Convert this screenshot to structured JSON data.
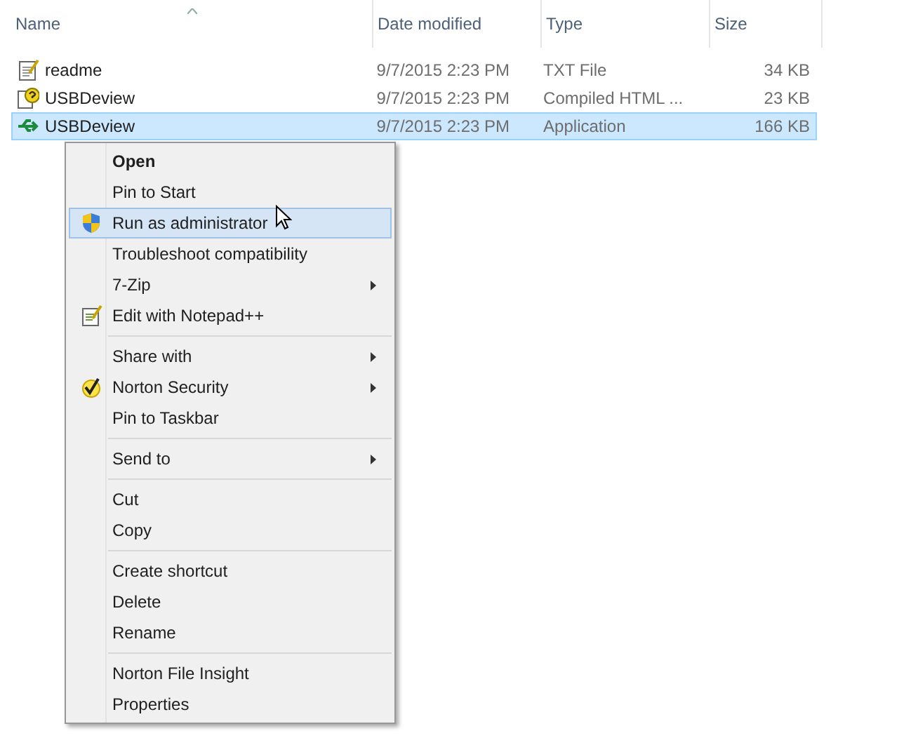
{
  "columns": [
    {
      "label": "Name",
      "sorted": true
    },
    {
      "label": "Date modified",
      "sorted": false
    },
    {
      "label": "Type",
      "sorted": false
    },
    {
      "label": "Size",
      "sorted": false
    }
  ],
  "files": [
    {
      "kind": "text",
      "name": "readme",
      "date": "9/7/2015 2:23 PM",
      "type": "TXT File",
      "size": "34 KB",
      "selected": false
    },
    {
      "kind": "help",
      "name": "USBDeview",
      "date": "9/7/2015 2:23 PM",
      "type": "Compiled HTML ...",
      "size": "23 KB",
      "selected": false
    },
    {
      "kind": "usb",
      "name": "USBDeview",
      "date": "9/7/2015 2:23 PM",
      "type": "Application",
      "size": "166 KB",
      "selected": true
    }
  ],
  "context_menu": {
    "groups": [
      [
        {
          "label": "Open",
          "bold": true,
          "selected": false,
          "submenu": false
        },
        {
          "label": "Pin to Start",
          "bold": false,
          "selected": false,
          "submenu": false
        },
        {
          "label": "Run as administrator",
          "kind": "shield",
          "bold": false,
          "selected": true,
          "submenu": false
        },
        {
          "label": "Troubleshoot compatibility",
          "bold": false,
          "selected": false,
          "submenu": false
        },
        {
          "label": "7-Zip",
          "bold": false,
          "selected": false,
          "submenu": true
        },
        {
          "label": "Edit with Notepad++",
          "kind": "notepad",
          "bold": false,
          "selected": false,
          "submenu": false
        }
      ],
      [
        {
          "label": "Share with",
          "bold": false,
          "selected": false,
          "submenu": true
        },
        {
          "label": "Norton Security",
          "kind": "check",
          "bold": false,
          "selected": false,
          "submenu": true
        },
        {
          "label": "Pin to Taskbar",
          "bold": false,
          "selected": false,
          "submenu": false
        }
      ],
      [
        {
          "label": "Send to",
          "bold": false,
          "selected": false,
          "submenu": true
        }
      ],
      [
        {
          "label": "Cut",
          "bold": false,
          "selected": false,
          "submenu": false
        },
        {
          "label": "Copy",
          "bold": false,
          "selected": false,
          "submenu": false
        }
      ],
      [
        {
          "label": "Create shortcut",
          "bold": false,
          "selected": false,
          "submenu": false
        },
        {
          "label": "Delete",
          "bold": false,
          "selected": false,
          "submenu": false
        },
        {
          "label": "Rename",
          "bold": false,
          "selected": false,
          "submenu": false
        }
      ],
      [
        {
          "label": "Norton File Insight",
          "bold": false,
          "selected": false,
          "submenu": false
        },
        {
          "label": "Properties",
          "bold": false,
          "selected": false,
          "submenu": false
        }
      ]
    ]
  }
}
